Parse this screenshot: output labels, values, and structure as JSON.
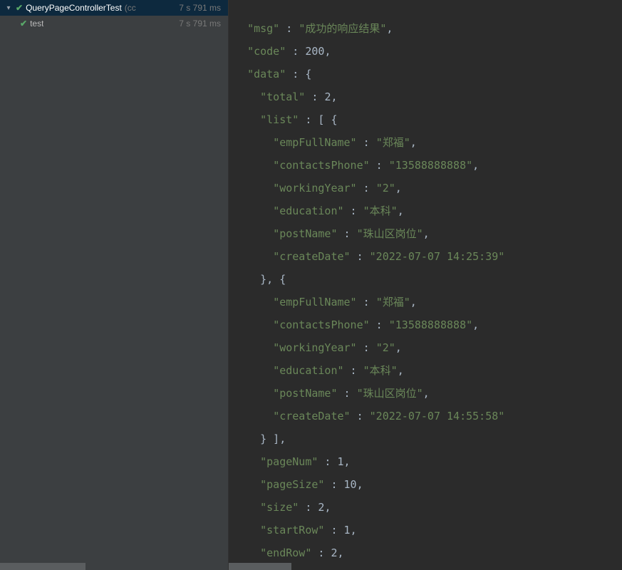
{
  "sidebar": {
    "tests": [
      {
        "name": "QueryPageControllerTest",
        "suffix": "(cc",
        "time": "7 s 791 ms",
        "selected": true,
        "expanded": true,
        "passed": true
      },
      {
        "name": "test",
        "suffix": "",
        "time": "7 s 791 ms",
        "selected": false,
        "expanded": false,
        "passed": true,
        "child": true
      }
    ]
  },
  "console": {
    "msg": "成功的响应结果",
    "code": 200,
    "data": {
      "total": 2,
      "list": [
        {
          "empFullName": "郑福",
          "contactsPhone": "13588888888",
          "workingYear": "2",
          "education": "本科",
          "postName": "珠山区岗位",
          "createDate": "2022-07-07 14:25:39"
        },
        {
          "empFullName": "郑福",
          "contactsPhone": "13588888888",
          "workingYear": "2",
          "education": "本科",
          "postName": "珠山区岗位",
          "createDate": "2022-07-07 14:55:58"
        }
      ],
      "pageNum": 1,
      "pageSize": 10,
      "size": 2,
      "startRow": 1,
      "endRow": 2
    }
  },
  "labels": {
    "indent1": "  ",
    "indent2": "    ",
    "indent3": "      ",
    "msg_key": "\"msg\"",
    "code_key": "\"code\"",
    "data_key": "\"data\"",
    "total_key": "\"total\"",
    "list_key": "\"list\"",
    "empFullName_key": "\"empFullName\"",
    "contactsPhone_key": "\"contactsPhone\"",
    "workingYear_key": "\"workingYear\"",
    "education_key": "\"education\"",
    "postName_key": "\"postName\"",
    "createDate_key": "\"createDate\"",
    "pageNum_key": "\"pageNum\"",
    "pageSize_key": "\"pageSize\"",
    "size_key": "\"size\"",
    "startRow_key": "\"startRow\"",
    "endRow_key": "\"endRow\""
  }
}
